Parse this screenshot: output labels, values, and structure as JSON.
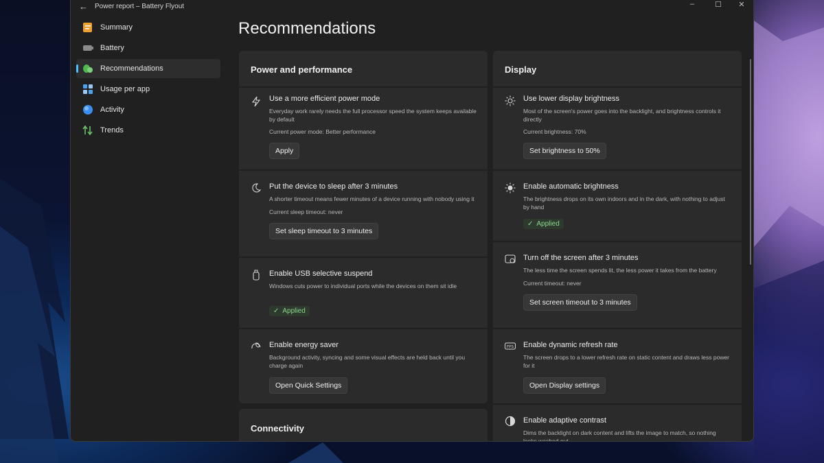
{
  "window": {
    "title": "Power report – Battery Flyout",
    "back_icon": "←",
    "controls": [
      "–",
      "☐",
      "✕"
    ]
  },
  "sidebar": {
    "items": [
      {
        "label": "Summary",
        "icon": "summary-icon",
        "color": "#f0a030"
      },
      {
        "label": "Battery",
        "icon": "battery-icon",
        "color": "#9a9a9a"
      },
      {
        "label": "Recommendations",
        "icon": "leaf-icon",
        "color": "#5cc05c",
        "active": true
      },
      {
        "label": "Usage per app",
        "icon": "apps-icon",
        "color": "#4aa3f0"
      },
      {
        "label": "Activity",
        "icon": "activity-icon",
        "color": "#3a8ef0"
      },
      {
        "label": "Trends",
        "icon": "trends-icon",
        "color": "#6ac06a"
      }
    ]
  },
  "main": {
    "title": "Recommendations",
    "power": {
      "header": "Power and performance",
      "rows": [
        {
          "title": "Use a more efficient power mode",
          "desc": "Everyday work rarely needs the full processor speed the system keeps available by default",
          "status": "Current power mode: Better performance",
          "action": "Apply",
          "icon": "power-mode-icon"
        },
        {
          "title": "Put the device to sleep after 3 minutes",
          "desc": "A shorter timeout means fewer minutes of a device running with nobody using it",
          "status": "Current sleep timeout: never",
          "action": "Set sleep timeout to 3 minutes",
          "icon": "moon-icon"
        },
        {
          "title": "Enable USB selective suspend",
          "desc": "Windows cuts power to individual ports while the devices on them sit idle",
          "applied": "Applied",
          "icon": "usb-icon"
        },
        {
          "title": "Enable energy saver",
          "desc": "Background activity, syncing and some visual effects are held back until you charge again",
          "action": "Open Quick Settings",
          "icon": "energy-saver-icon"
        }
      ]
    },
    "connectivity": {
      "header": "Connectivity"
    },
    "display": {
      "header": "Display",
      "rows": [
        {
          "title": "Use lower display brightness",
          "desc": "Most of the screen's power goes into the backlight, and brightness controls it directly",
          "status": "Current brightness: 70%",
          "action": "Set brightness to 50%",
          "icon": "sun-icon"
        },
        {
          "title": "Enable automatic brightness",
          "desc": "The brightness drops on its own indoors and in the dark, with nothing to adjust by hand",
          "applied": "Applied",
          "icon": "auto-brightness-icon"
        },
        {
          "title": "Turn off the screen after 3 minutes",
          "desc": "The less time the screen spends lit, the less power it takes from the battery",
          "status": "Current timeout: never",
          "action": "Set screen timeout to 3 minutes",
          "icon": "screen-timeout-icon"
        },
        {
          "title": "Enable dynamic refresh rate",
          "desc": "The screen drops to a lower refresh rate on static content and draws less power for it",
          "action": "Open Display settings",
          "icon": "fps-icon"
        },
        {
          "title": "Enable adaptive contrast",
          "desc": "Dims the backlight on dark content and lifts the image to match, so nothing looks washed out",
          "icon": "contrast-icon"
        }
      ]
    }
  }
}
